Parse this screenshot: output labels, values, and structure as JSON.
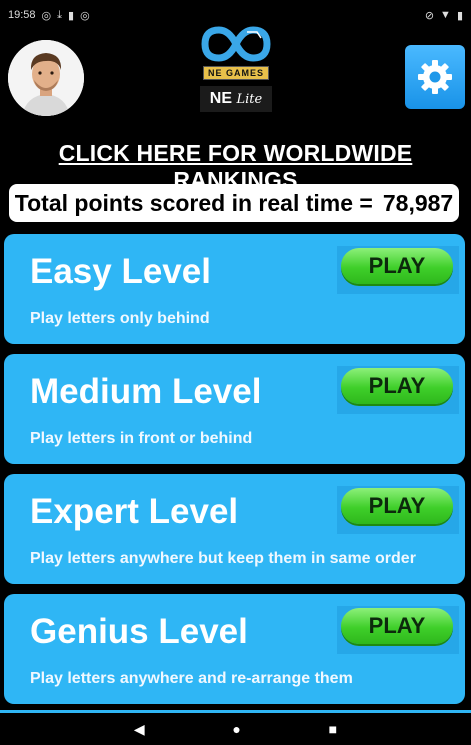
{
  "status_bar": {
    "time": "19:58",
    "left_icons": [
      "whatsapp-icon",
      "download-icon",
      "sim-icon",
      "whatsapp-icon"
    ],
    "right_icons": [
      "mute-icon",
      "wifi-icon",
      "battery-icon"
    ]
  },
  "header": {
    "brand": "NE GAMES",
    "app_name": "NE",
    "app_variant": "Lite"
  },
  "rankings_link": "CLICK HERE FOR WORLDWIDE RANKINGS",
  "points": {
    "label": "Total points scored in real time =",
    "value": "78,987"
  },
  "levels": [
    {
      "title": "Easy Level",
      "description": "Play letters only behind",
      "play_label": "PLAY"
    },
    {
      "title": "Medium Level",
      "description": "Play letters in front or behind",
      "play_label": "PLAY"
    },
    {
      "title": "Expert Level",
      "description": "Play letters anywhere but keep them in same order",
      "play_label": "PLAY"
    },
    {
      "title": "Genius Level",
      "description": "Play letters anywhere and re-arrange them",
      "play_label": "PLAY"
    }
  ],
  "nav": {
    "back": "◀",
    "home": "●",
    "recents": "■"
  },
  "colors": {
    "level_bg": "#2fb6f5",
    "play_green": "#3fcf2a",
    "settings_blue": "#1993e8"
  }
}
